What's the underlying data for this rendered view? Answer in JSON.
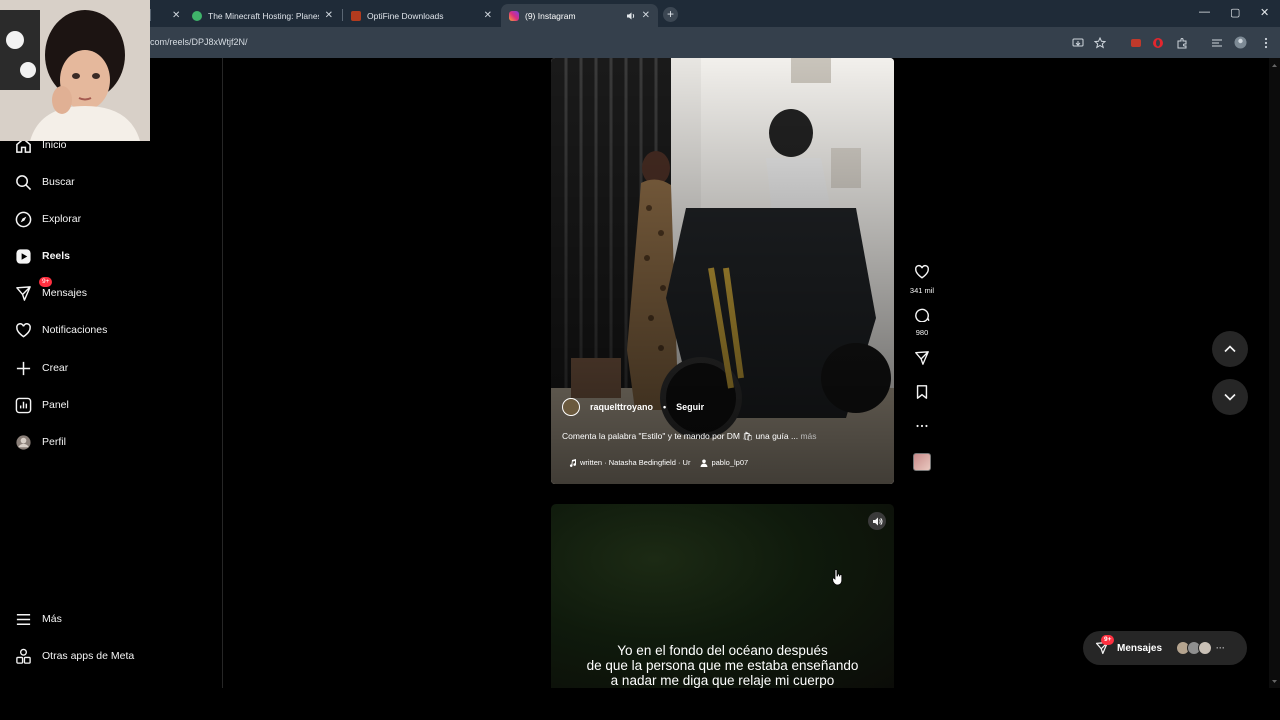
{
  "browser": {
    "tabs": [
      {
        "title": "The Minecraft Hosting: Planes ·",
        "close": "✕"
      },
      {
        "title": "OptiFine Downloads",
        "close": "✕"
      },
      {
        "title": "(9) Instagram",
        "close": "✕"
      }
    ],
    "first_tab_close": "✕",
    "new_tab": "+",
    "url": "com/reels/DPJ8xWtjf2N/",
    "window_controls": [
      "—",
      "▢",
      "✕"
    ]
  },
  "sidebar": {
    "items": [
      {
        "label": "Inicio",
        "icon": "home-icon"
      },
      {
        "label": "Buscar",
        "icon": "search-icon"
      },
      {
        "label": "Explorar",
        "icon": "compass-icon"
      },
      {
        "label": "Reels",
        "icon": "reels-icon"
      },
      {
        "label": "Mensajes",
        "icon": "messenger-icon",
        "badge": "9+"
      },
      {
        "label": "Notificaciones",
        "icon": "heart-icon"
      },
      {
        "label": "Crear",
        "icon": "plus-icon"
      },
      {
        "label": "Panel",
        "icon": "chart-icon"
      },
      {
        "label": "Perfil",
        "icon": "avatar-icon"
      }
    ],
    "bottom_items": [
      {
        "label": "Más",
        "icon": "menu-icon"
      },
      {
        "label": "Otras apps de Meta",
        "icon": "meta-apps-icon"
      }
    ]
  },
  "reel": {
    "username": "raquelttroyano",
    "separator": "•",
    "follow": "Seguir",
    "caption": "Comenta la palabra \"Estilo\" y te mando por DM 🛍 una guía ...",
    "more": "más",
    "audio": "written · Natasha Bedingfield · Ur",
    "tagged_user": "pablo_lp07",
    "likes": "341 mil",
    "comments": "980"
  },
  "next_reel": {
    "subtitle_lines": [
      "Yo en el fondo del océano después",
      "de que la persona que me estaba enseñando",
      "a nadar me diga que relaje mi cuerpo"
    ]
  },
  "messages_pill": {
    "label": "Mensajes",
    "badge": "9+",
    "more": "···"
  },
  "colors": {
    "badge": "#ff3040",
    "tabbar": "#1f2b38",
    "addressbar": "#35404c",
    "background": "#000000"
  }
}
